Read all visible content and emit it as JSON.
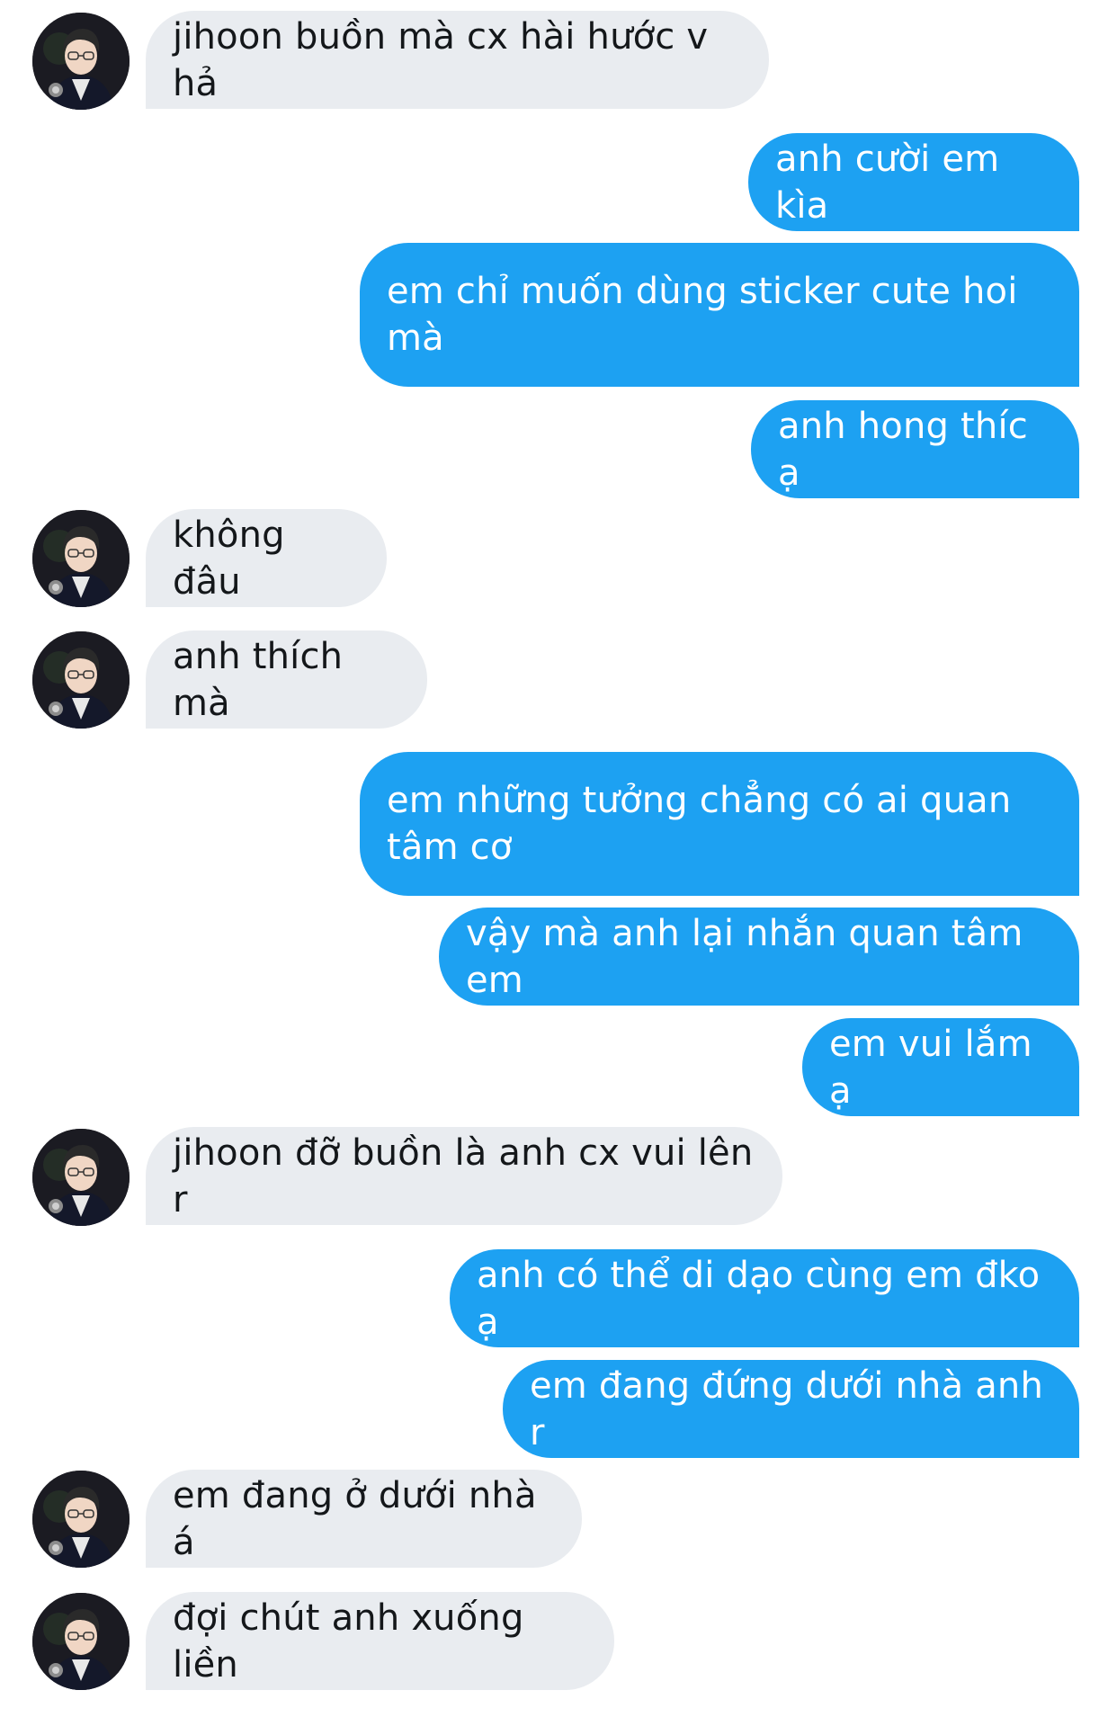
{
  "conversation": {
    "messages": [
      {
        "side": "in",
        "text": "jihoon buồn mà cx hài hước v hả"
      },
      {
        "side": "out",
        "text": "anh cười em kìa"
      },
      {
        "side": "out",
        "text": "em chỉ muốn dùng sticker cute hoi mà"
      },
      {
        "side": "out",
        "text": "anh hong thíc ạ"
      },
      {
        "side": "in",
        "text": "không đâu"
      },
      {
        "side": "in",
        "text": "anh thích mà"
      },
      {
        "side": "out",
        "text": "em những tưởng chẳng có ai quan tâm cơ"
      },
      {
        "side": "out",
        "text": "vậy mà anh lại nhắn quan tâm em"
      },
      {
        "side": "out",
        "text": "em vui lắm ạ"
      },
      {
        "side": "in",
        "text": "jihoon đỡ buồn là anh cx vui lên r"
      },
      {
        "side": "out",
        "text": "anh có thể di dạo cùng em đko ạ"
      },
      {
        "side": "out",
        "text": "em đang đứng dưới nhà anh r"
      },
      {
        "side": "in",
        "text": "em đang ở dưới nhà á"
      },
      {
        "side": "in",
        "text": "đợi chút anh xuống liền"
      }
    ]
  },
  "theme": {
    "incoming_bubble": "#e9ecf0",
    "outgoing_bubble": "#1da1f2",
    "incoming_text": "#14171a",
    "outgoing_text": "#ffffff"
  },
  "contact": {
    "avatar_icon": "user-avatar-icon"
  }
}
